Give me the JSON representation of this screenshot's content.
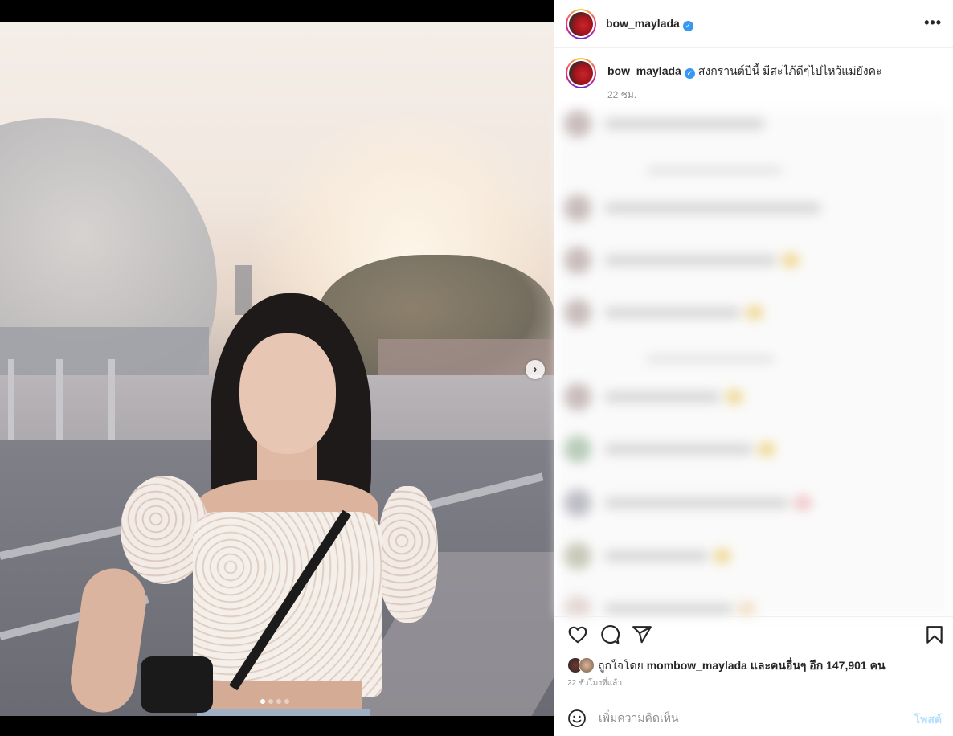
{
  "post": {
    "username": "bow_maylada",
    "verified": true,
    "more_label": "•••",
    "caption": "สงกรานต์ปีนี้ มีสะไภ้ดีๆไปไหว้แม่ยังคะ",
    "caption_time": "22 ชม.",
    "carousel": {
      "total": 4,
      "active_index": 0
    }
  },
  "likes": {
    "text_prefix": "ถูกใจโดย",
    "first_liker": "mombow_maylada",
    "text_middle": "และคนอื่นๆ อีก",
    "count": "147,901",
    "unit": "คน"
  },
  "post_time": "22 ชั่วโมงที่แล้ว",
  "comment_box": {
    "placeholder": "เพิ่มความคิดเห็น",
    "post_label": "โพสต์"
  },
  "colors": {
    "verified": "#3897f0",
    "post_button_disabled": "#b2dffc",
    "story_ring": [
      "#f9ce34",
      "#ee2a7b",
      "#6228d7"
    ]
  }
}
